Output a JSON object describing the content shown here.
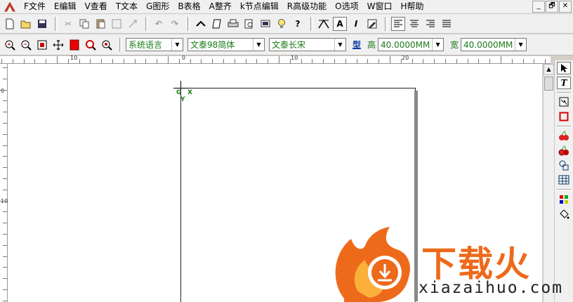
{
  "menu": [
    "F文件",
    "E编辑",
    "V查看",
    "T文本",
    "G图形",
    "B表格",
    "A整齐",
    "k节点编辑",
    "R高级功能",
    "O选项",
    "W窗口",
    "H帮助"
  ],
  "window_buttons": [
    "_",
    "🗗",
    "✕"
  ],
  "toolbar1": {
    "text_tools": [
      "A",
      "I"
    ]
  },
  "toolbar2": {
    "language": "系统语言",
    "font": "文泰98简体",
    "font2": "文泰长宋",
    "style_label": "型",
    "height_label": "高",
    "height_value": "40.0000MM",
    "width_label": "宽",
    "width_value": "40.0000MM"
  },
  "ruler_top": [
    "10",
    "0",
    "10",
    "20"
  ],
  "ruler_left": [
    "0",
    "10"
  ],
  "canvas": {
    "origin_g": "G",
    "origin_x": "X",
    "origin_y": "Y"
  },
  "right_tools": {
    "text_tool": "T"
  },
  "watermark": {
    "brand": "下载火",
    "domain": "xiazaihuo.com"
  },
  "colors": {
    "accent_green": "#1a7a1a",
    "brand_orange": "#ee6a1b"
  }
}
